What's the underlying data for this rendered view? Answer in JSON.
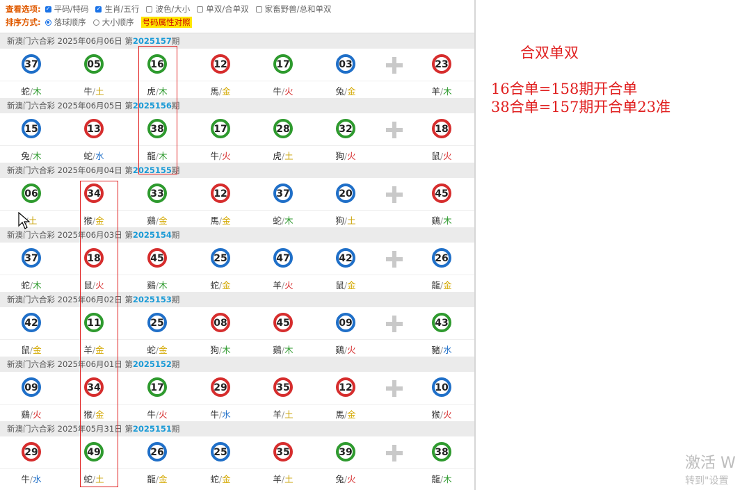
{
  "options": {
    "view_label": "查看选项:",
    "view": [
      {
        "label": "平码/特码",
        "checked": true
      },
      {
        "label": "生肖/五行",
        "checked": true
      },
      {
        "label": "波色/大小",
        "checked": false
      },
      {
        "label": "单双/合单双",
        "checked": false
      },
      {
        "label": "家畜野兽/总和单双",
        "checked": false
      }
    ],
    "sort_label": "排序方式:",
    "sort": [
      {
        "label": "落球顺序",
        "selected": true
      },
      {
        "label": "大小顺序",
        "selected": false
      }
    ],
    "attr_link": "号码属性对照"
  },
  "draws": [
    {
      "lottery": "新澳门六合彩",
      "date": "2025年06月06日",
      "prefix": "第",
      "issue": "2025157",
      "suffix": "期",
      "balls": [
        {
          "n": "37",
          "c": "blue",
          "z": "蛇",
          "e": "木"
        },
        {
          "n": "05",
          "c": "green",
          "z": "牛",
          "e": "土"
        },
        {
          "n": "16",
          "c": "green",
          "z": "虎",
          "e": "木"
        },
        {
          "n": "12",
          "c": "red",
          "z": "馬",
          "e": "金"
        },
        {
          "n": "17",
          "c": "green",
          "z": "牛",
          "e": "火"
        },
        {
          "n": "03",
          "c": "blue",
          "z": "兔",
          "e": "金"
        },
        {
          "n": "23",
          "c": "red",
          "z": "羊",
          "e": "木"
        }
      ]
    },
    {
      "lottery": "新澳门六合彩",
      "date": "2025年06月05日",
      "prefix": "第",
      "issue": "2025156",
      "suffix": "期",
      "balls": [
        {
          "n": "15",
          "c": "blue",
          "z": "兔",
          "e": "木"
        },
        {
          "n": "13",
          "c": "red",
          "z": "蛇",
          "e": "水"
        },
        {
          "n": "38",
          "c": "green",
          "z": "龍",
          "e": "木"
        },
        {
          "n": "17",
          "c": "green",
          "z": "牛",
          "e": "火"
        },
        {
          "n": "28",
          "c": "green",
          "z": "虎",
          "e": "土"
        },
        {
          "n": "32",
          "c": "green",
          "z": "狗",
          "e": "火"
        },
        {
          "n": "18",
          "c": "red",
          "z": "鼠",
          "e": "火"
        }
      ]
    },
    {
      "lottery": "新澳门六合彩",
      "date": "2025年06月04日",
      "prefix": "第",
      "issue": "2025155",
      "suffix": "期",
      "balls": [
        {
          "n": "06",
          "c": "green",
          "z": "",
          "e": "土"
        },
        {
          "n": "34",
          "c": "red",
          "z": "猴",
          "e": "金"
        },
        {
          "n": "33",
          "c": "green",
          "z": "鷄",
          "e": "金"
        },
        {
          "n": "12",
          "c": "red",
          "z": "馬",
          "e": "金"
        },
        {
          "n": "37",
          "c": "blue",
          "z": "蛇",
          "e": "木"
        },
        {
          "n": "20",
          "c": "blue",
          "z": "狗",
          "e": "土"
        },
        {
          "n": "45",
          "c": "red",
          "z": "鷄",
          "e": "木"
        }
      ]
    },
    {
      "lottery": "新澳门六合彩",
      "date": "2025年06月03日",
      "prefix": "第",
      "issue": "2025154",
      "suffix": "期",
      "balls": [
        {
          "n": "37",
          "c": "blue",
          "z": "蛇",
          "e": "木"
        },
        {
          "n": "18",
          "c": "red",
          "z": "鼠",
          "e": "火"
        },
        {
          "n": "45",
          "c": "red",
          "z": "鷄",
          "e": "木"
        },
        {
          "n": "25",
          "c": "blue",
          "z": "蛇",
          "e": "金"
        },
        {
          "n": "47",
          "c": "blue",
          "z": "羊",
          "e": "火"
        },
        {
          "n": "42",
          "c": "blue",
          "z": "鼠",
          "e": "金"
        },
        {
          "n": "26",
          "c": "blue",
          "z": "龍",
          "e": "金"
        }
      ]
    },
    {
      "lottery": "新澳门六合彩",
      "date": "2025年06月02日",
      "prefix": "第",
      "issue": "2025153",
      "suffix": "期",
      "balls": [
        {
          "n": "42",
          "c": "blue",
          "z": "鼠",
          "e": "金"
        },
        {
          "n": "11",
          "c": "green",
          "z": "羊",
          "e": "金"
        },
        {
          "n": "25",
          "c": "blue",
          "z": "蛇",
          "e": "金"
        },
        {
          "n": "08",
          "c": "red",
          "z": "狗",
          "e": "木"
        },
        {
          "n": "45",
          "c": "red",
          "z": "鷄",
          "e": "木"
        },
        {
          "n": "09",
          "c": "blue",
          "z": "鷄",
          "e": "火"
        },
        {
          "n": "43",
          "c": "green",
          "z": "豬",
          "e": "水"
        }
      ]
    },
    {
      "lottery": "新澳门六合彩",
      "date": "2025年06月01日",
      "prefix": "第",
      "issue": "2025152",
      "suffix": "期",
      "balls": [
        {
          "n": "09",
          "c": "blue",
          "z": "鷄",
          "e": "火"
        },
        {
          "n": "34",
          "c": "red",
          "z": "猴",
          "e": "金"
        },
        {
          "n": "17",
          "c": "green",
          "z": "牛",
          "e": "火"
        },
        {
          "n": "29",
          "c": "red",
          "z": "牛",
          "e": "水"
        },
        {
          "n": "35",
          "c": "red",
          "z": "羊",
          "e": "土"
        },
        {
          "n": "12",
          "c": "red",
          "z": "馬",
          "e": "金"
        },
        {
          "n": "10",
          "c": "blue",
          "z": "猴",
          "e": "火"
        }
      ]
    },
    {
      "lottery": "新澳门六合彩",
      "date": "2025年05月31日",
      "prefix": "第",
      "issue": "2025151",
      "suffix": "期",
      "balls": [
        {
          "n": "29",
          "c": "red",
          "z": "牛",
          "e": "水"
        },
        {
          "n": "49",
          "c": "green",
          "z": "蛇",
          "e": "土"
        },
        {
          "n": "26",
          "c": "blue",
          "z": "龍",
          "e": "金"
        },
        {
          "n": "25",
          "c": "blue",
          "z": "蛇",
          "e": "金"
        },
        {
          "n": "35",
          "c": "red",
          "z": "羊",
          "e": "土"
        },
        {
          "n": "39",
          "c": "green",
          "z": "兔",
          "e": "火"
        },
        {
          "n": "38",
          "c": "green",
          "z": "龍",
          "e": "木"
        }
      ]
    }
  ],
  "notes": {
    "title": "合双单双",
    "line1": "16合单=158期开合单",
    "line2": "38合单=157期开合单23准"
  },
  "watermark": {
    "line1": "激活 W",
    "line2": "转到\"设置"
  }
}
